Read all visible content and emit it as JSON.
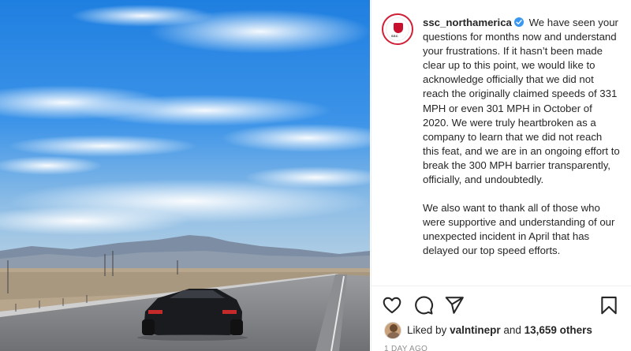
{
  "post": {
    "username": "ssc_northamerica",
    "caption_p1": "We have seen your questions for months now and understand your frustrations. If it hasn’t been made clear up to this point, we would like to acknowledge officially that we did not reach the originally claimed speeds of 331 MPH or even 301 MPH in October of 2020. We were truly heartbroken as a company to learn that we did not reach this feat, and we are in an ongoing effort to break the 300 MPH barrier transparently, officially, and undoubtedly.",
    "caption_p2": "We also want to thank all of those who were supportive and understanding of our unexpected incident in April that has delayed our top speed efforts.",
    "avatar_logo_text": "SSC",
    "liked_by_prefix": "Liked by",
    "liked_by_user": "valntinepr",
    "liked_by_conj": "and",
    "liked_by_others": "13,659 others",
    "time_ago": "1 DAY AGO"
  },
  "icons": {
    "like": "heart-icon",
    "comment": "comment-icon",
    "share": "share-icon",
    "save": "bookmark-icon",
    "verified": "verified-badge-icon"
  },
  "colors": {
    "verified": "#3897f0",
    "text": "#262626",
    "muted": "#8e8e8e",
    "avatar_ring": "#d01f36"
  }
}
